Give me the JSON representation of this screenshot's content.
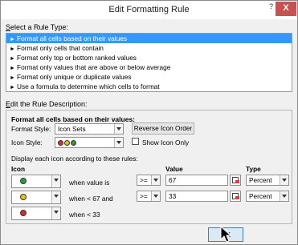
{
  "dialog": {
    "title": "Edit Formatting Rule",
    "help": "?",
    "close": "X"
  },
  "rule_type": {
    "label_prefix": "S",
    "label_rest": "elect a Rule Type:",
    "items": [
      "Format all cells based on their values",
      "Format only cells that contain",
      "Format only top or bottom ranked values",
      "Format only values that are above or below average",
      "Format only unique or duplicate values",
      "Use a formula to determine which cells to format"
    ],
    "selected_index": 0
  },
  "description": {
    "label_prefix": "E",
    "label_rest": "dit the Rule Description:",
    "heading": "Format all cells based on their values:",
    "format_style_label": "Format Style:",
    "format_style_value": "Icon Sets",
    "reverse_button": "Reverse Icon Order",
    "icon_style_label": "Icon Style:",
    "show_icon_only": "Show Icon Only",
    "display_text": "Display each icon according to these rules:",
    "col_icon": "Icon",
    "col_value": "Value",
    "col_type": "Type",
    "rows": [
      {
        "icon_color": "#2e9e2e",
        "label": "when value is",
        "operator": ">=",
        "value": "67",
        "type": "Percent"
      },
      {
        "icon_color": "#e8c21a",
        "label": "when < 67 and",
        "operator": ">=",
        "value": "33",
        "type": "Percent"
      },
      {
        "icon_color": "#d92b2b",
        "label": "when < 33"
      }
    ],
    "icon_style_colors": [
      "#d92b2b",
      "#e8c21a",
      "#2e9e2e"
    ]
  },
  "buttons": {
    "ok": "OK"
  }
}
